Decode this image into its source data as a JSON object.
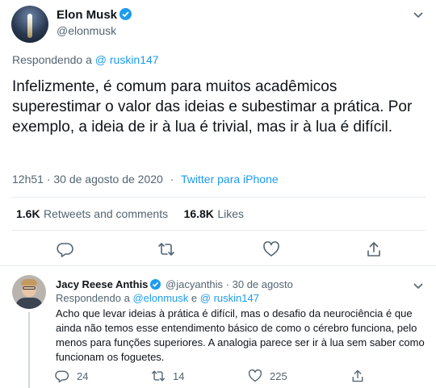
{
  "main_tweet": {
    "author_name": "Elon Musk",
    "author_handle": "@elonmusk",
    "replying_label": "Respondendo a",
    "replying_to": "@ ruskin147",
    "text": "Infelizmente, é comum para muitos acadêmicos superestimar o valor das ideias e subestimar a prática. Por exemplo, a ideia de ir à lua é trivial, mas ir à lua é difícil.",
    "time": "12h51 · 30 de agosto de 2020",
    "sep": "·",
    "source": "Twitter para iPhone",
    "retweets_count": "1.6K",
    "retweets_label": "Retweets and comments",
    "likes_count": "16.8K",
    "likes_label": "Likes"
  },
  "reply_tweet": {
    "author_name": "Jacy Reese Anthis",
    "author_handle": "@jacyanthis",
    "date": "· 30 de agosto",
    "replying_label": "Respondendo a",
    "replying_to_1": "@elonmusk",
    "replying_and": "e",
    "replying_to_2": "@ ruskin147",
    "text": "Acho que levar ideias à prática é difícil, mas o desafio da neurociência é que ainda não temos esse entendimento básico de como o cérebro funciona, pelo menos para funções superiores. A analogia parece ser ir à lua sem saber como funcionam os foguetes.",
    "reply_count": "24",
    "retweet_count": "14",
    "like_count": "225"
  },
  "icons": {
    "verified": "verified-badge-icon",
    "chevron": "chevron-down-icon",
    "reply": "reply-icon",
    "retweet": "retweet-icon",
    "like": "heart-icon",
    "share": "share-icon"
  },
  "colors": {
    "accent": "#1d9bf0",
    "text": "#0f1419",
    "secondary": "#536471",
    "divider": "#e6ecf0"
  }
}
